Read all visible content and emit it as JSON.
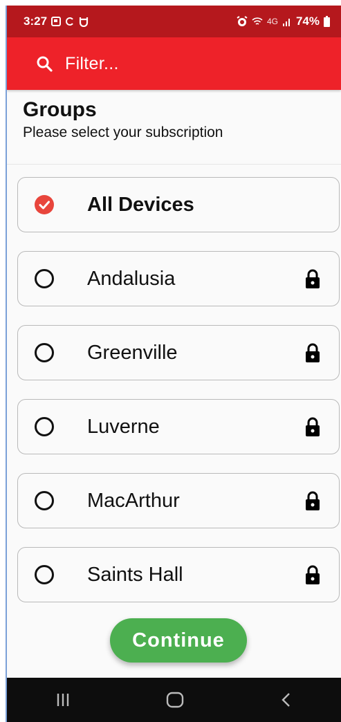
{
  "status_bar": {
    "time": "3:27",
    "battery": "74%",
    "network": "4G",
    "left_icons": [
      "screenshot-icon",
      "sync-icon",
      "shield-icon"
    ],
    "right_icons": [
      "alarm-icon",
      "wifi-icon",
      "signal-icon",
      "battery-icon"
    ]
  },
  "topbar": {
    "search_icon": "search-icon",
    "placeholder": "Filter..."
  },
  "header": {
    "title": "Groups",
    "subtitle": "Please select your subscription"
  },
  "groups": [
    {
      "label": "All Devices",
      "selected": true,
      "locked": false
    },
    {
      "label": "Andalusia",
      "selected": false,
      "locked": true
    },
    {
      "label": "Greenville",
      "selected": false,
      "locked": true
    },
    {
      "label": "Luverne",
      "selected": false,
      "locked": true
    },
    {
      "label": "MacArthur",
      "selected": false,
      "locked": true
    },
    {
      "label": "Saints Hall",
      "selected": false,
      "locked": true
    }
  ],
  "continue_label": "Continue",
  "colors": {
    "status_bar": "#b5181d",
    "topbar": "#ee2229",
    "selected": "#e8453c",
    "button": "#4caf50"
  },
  "navbar": [
    "recent-apps-icon",
    "home-icon",
    "back-icon"
  ]
}
